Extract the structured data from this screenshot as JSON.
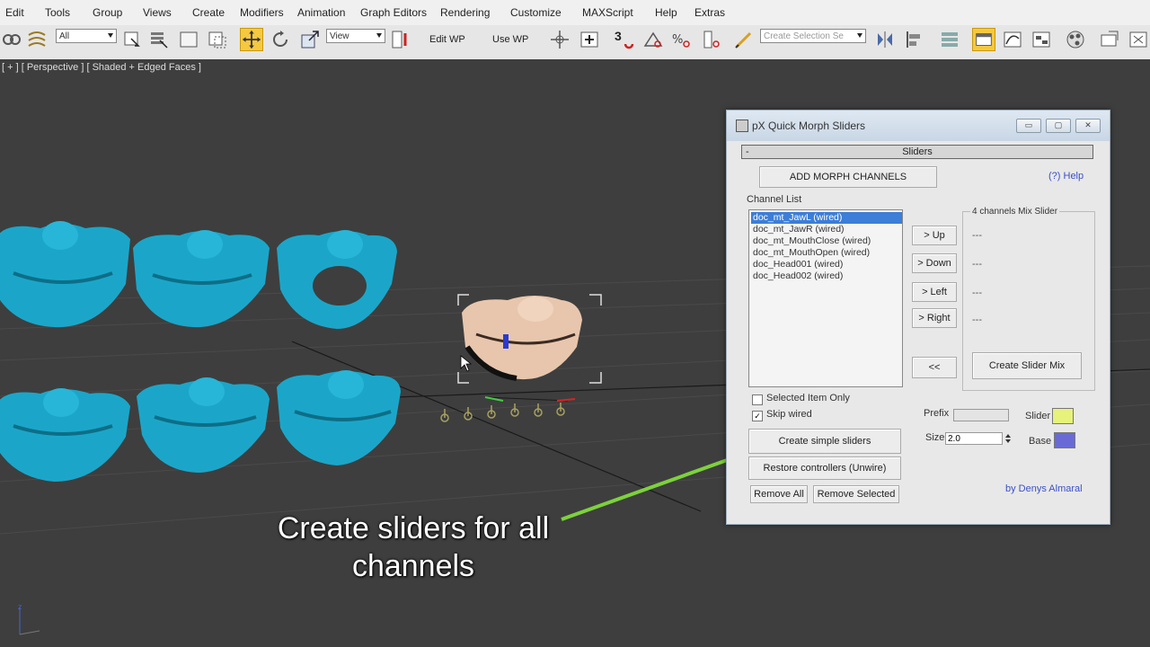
{
  "menubar": {
    "items": [
      "Edit",
      "Tools",
      "Group",
      "Views",
      "Create",
      "Modifiers",
      "Animation",
      "Graph Editors",
      "Rendering",
      "Customize",
      "MAXScript",
      "Help",
      "Extras"
    ]
  },
  "toolbar": {
    "filter_value": "All",
    "ref_coord_value": "View",
    "edit_wp_label": "Edit WP",
    "use_wp_label": "Use WP",
    "selection_set_placeholder": "Create Selection Se",
    "snap_label": "3"
  },
  "viewport": {
    "label": "[ + ] [ Perspective ] [ Shaded + Edged Faces ]",
    "overlay_text": "Create sliders for all channels",
    "colors": {
      "mesh": "#1ba6c9",
      "selected_mesh": "#e8c6ad",
      "arrow": "#7cd23c"
    }
  },
  "dialog": {
    "title": "pX Quick Morph Sliders",
    "window_buttons": {
      "minimize": "▭",
      "maximize": "▢",
      "close": "✕"
    },
    "rollout_label": "Sliders",
    "rollout_minus": "-",
    "add_channels_label": "ADD MORPH CHANNELS",
    "help_label": "(?) Help",
    "channel_list_label": "Channel List",
    "channels": [
      "doc_mt_JawL (wired)",
      "doc_mt_JawR (wired)",
      "doc_mt_MouthClose (wired)",
      "doc_mt_MouthOpen (wired)",
      "doc_Head001 (wired)",
      "doc_Head002 (wired)"
    ],
    "up_label": "> Up",
    "down_label": "> Down",
    "left_label": "> Left",
    "right_label": "> Right",
    "back_label": "<<",
    "mix_group_label": "4 channels Mix Slider",
    "mix_dashes": [
      "---",
      "---",
      "---",
      "---"
    ],
    "create_mix_label": "Create Slider Mix",
    "selected_only_label": "Selected Item Only",
    "selected_only_checked": false,
    "skip_wired_label": "Skip wired",
    "skip_wired_checked": true,
    "check_mark": "✓",
    "prefix_label": "Prefix",
    "prefix_value": "",
    "size_label": "Size",
    "size_value": "2.0",
    "slider_label": "Slider",
    "slider_color": "#e6f27a",
    "base_label": "Base",
    "base_color": "#6a6ad6",
    "create_simple_label": "Create simple sliders",
    "restore_label": "Restore controllers (Unwire)",
    "remove_all_label": "Remove All",
    "remove_selected_label": "Remove Selected",
    "credit": "by Denys Almaral"
  }
}
